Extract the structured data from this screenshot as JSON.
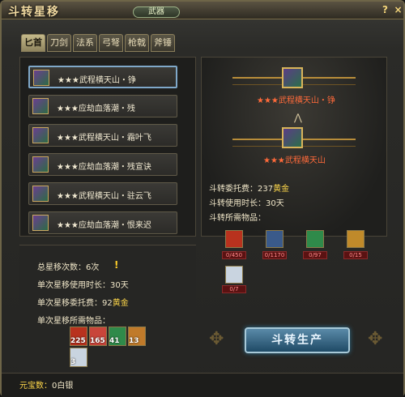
{
  "window": {
    "title": "斗转星移",
    "category_label": "武器",
    "help_label": "?",
    "close_label": "×"
  },
  "tabs": [
    {
      "label": "匕首",
      "active": true
    },
    {
      "label": "刀剑",
      "active": false
    },
    {
      "label": "法系",
      "active": false
    },
    {
      "label": "弓弩",
      "active": false
    },
    {
      "label": "枪戟",
      "active": false
    },
    {
      "label": "斧锤",
      "active": false
    }
  ],
  "recipes": [
    {
      "label": "★★★武程横天山・铮",
      "selected": true
    },
    {
      "label": "★★★应劫血落潮・残",
      "selected": false
    },
    {
      "label": "★★★武程横天山・霜叶飞",
      "selected": false
    },
    {
      "label": "★★★应劫血落潮・残宣诀",
      "selected": false
    },
    {
      "label": "★★★武程横天山・驻云飞",
      "selected": false
    },
    {
      "label": "★★★应劫血落潮・恨来迟",
      "selected": false
    }
  ],
  "left_stats": {
    "total_count_label": "总星移次数：",
    "total_count_value": "6次",
    "exclaim": "!",
    "single_time_label": "单次星移使用时长：",
    "single_time_value": "30天",
    "single_fee_label": "单次星移委托费：",
    "single_fee_value": "92",
    "single_fee_unit": "黄金",
    "materials_label": "单次星移所需物品：",
    "materials": [
      {
        "icon": "red-gem-icon",
        "count": "225",
        "color": "#b8321e"
      },
      {
        "icon": "red-orb-icon",
        "count": "165",
        "color": "#c8453a"
      },
      {
        "icon": "green-crystal-icon",
        "count": "41",
        "color": "#2f8a4a"
      },
      {
        "icon": "orange-scroll-icon",
        "count": "13",
        "color": "#c07a2a"
      },
      {
        "icon": "white-feather-icon",
        "count": "3",
        "color": "#c9d4e0"
      }
    ]
  },
  "right_panel": {
    "target_name": "★★★武程横天山・铮",
    "source_name": "★★★武程横天山",
    "fee_label": "斗转委托费：",
    "fee_value": "237",
    "fee_unit": "黄金",
    "time_label": "斗转使用时长：",
    "time_value": "30天",
    "materials_label": "斗转所需物品：",
    "materials": [
      {
        "icon": "red-gem-icon",
        "count": "0/450",
        "color": "#b8321e"
      },
      {
        "icon": "blue-orb-icon",
        "count": "0/1170",
        "color": "#3a5a8a"
      },
      {
        "icon": "green-crystal-icon",
        "count": "0/97",
        "color": "#2f8a4a"
      },
      {
        "icon": "gold-scroll-icon",
        "count": "0/15",
        "color": "#c08a2a"
      },
      {
        "icon": "white-feather-icon",
        "count": "0/7",
        "color": "#c9d4e0"
      }
    ]
  },
  "produce_button": {
    "label": "斗转生产"
  },
  "footer": {
    "yuanbao_label": "元宝数：",
    "yuanbao_value": "0白银"
  }
}
